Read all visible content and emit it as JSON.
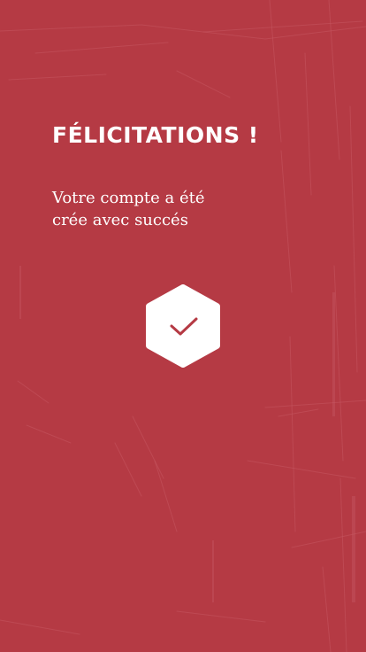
{
  "screen": {
    "title": "FÉLICITATIONS !",
    "message_line_1": "Votre compte a été",
    "message_line_2": "crée avec succés",
    "success_icon": "check-icon",
    "colors": {
      "background": "#b53a44",
      "text": "#ffffff",
      "badge_fill": "#ffffff",
      "check_stroke": "#b53a44"
    }
  }
}
